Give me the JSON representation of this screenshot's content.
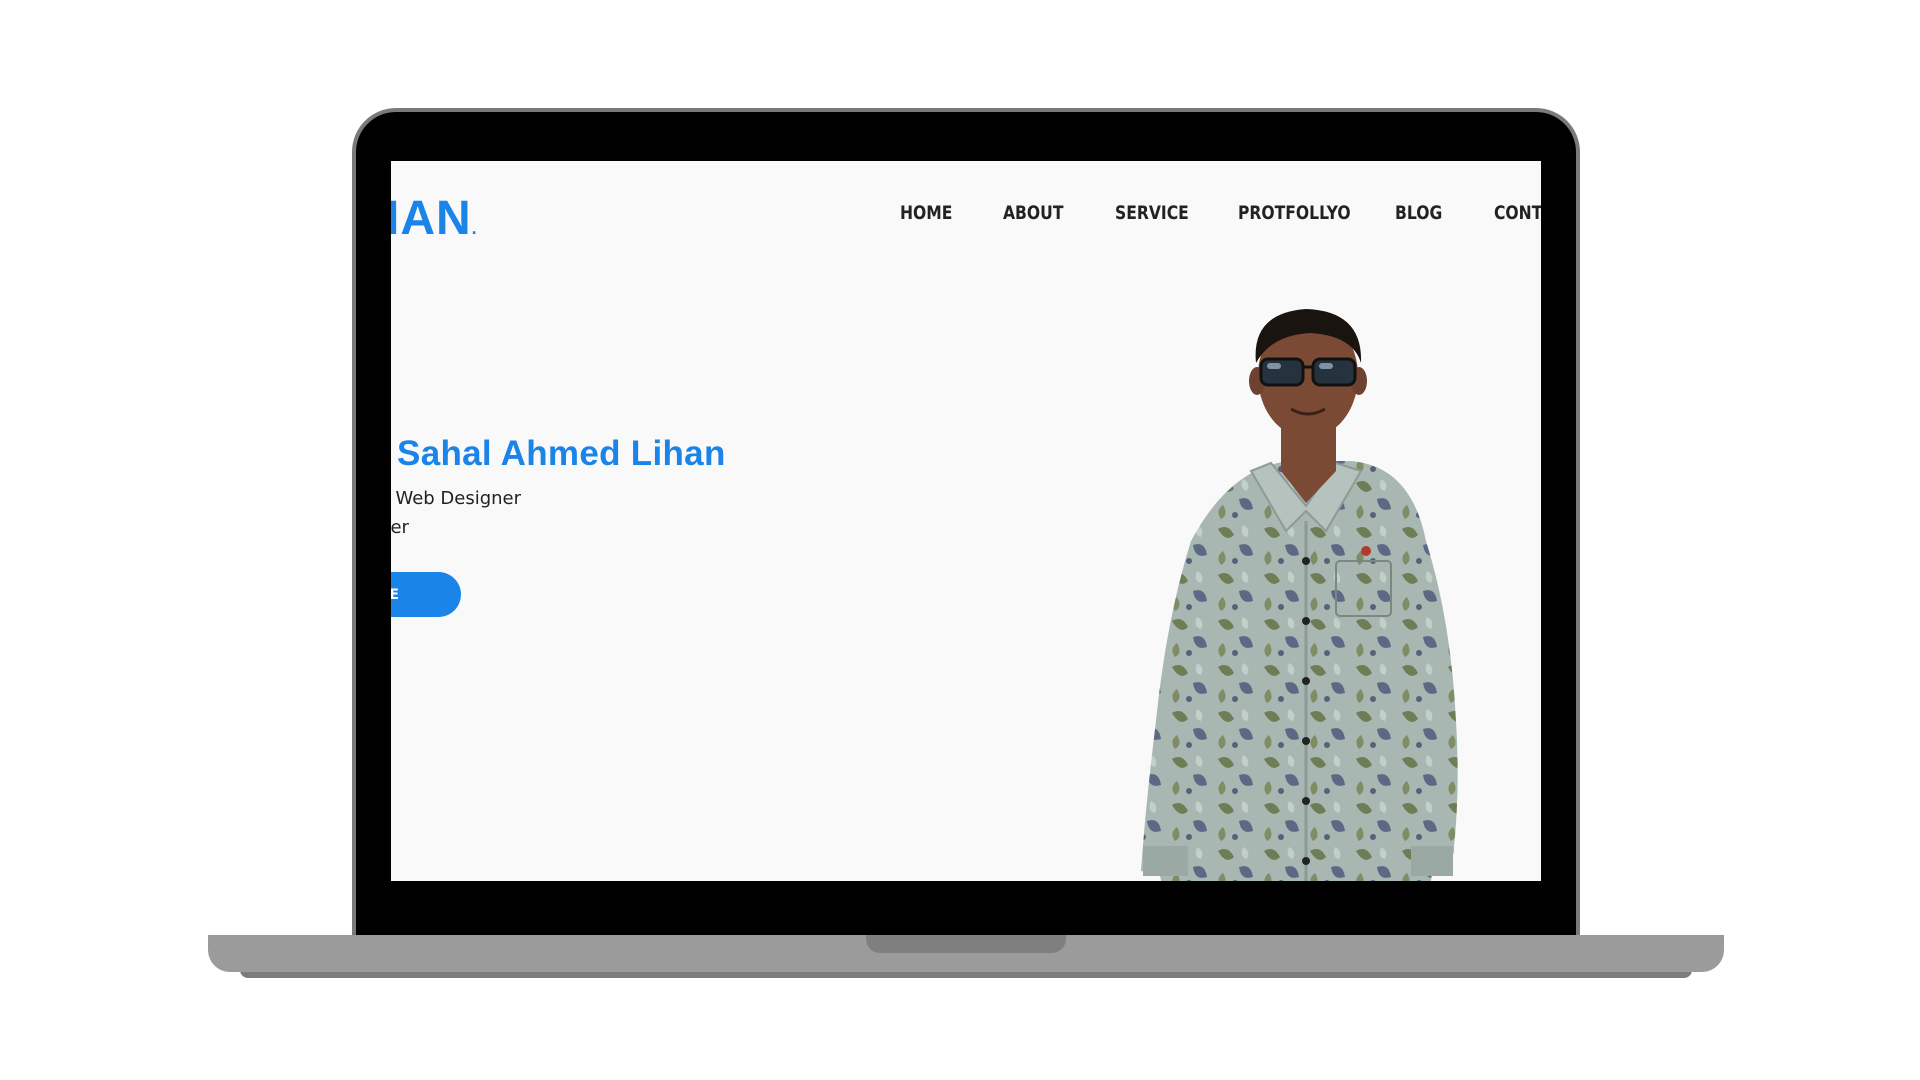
{
  "site": {
    "logo_text": "IAN",
    "logo_dot": "."
  },
  "nav": {
    "items": [
      {
        "label": "HOME"
      },
      {
        "label": "ABOUT"
      },
      {
        "label": "SERVICE"
      },
      {
        "label": "PROTFOLLYO"
      },
      {
        "label": "BLOG"
      },
      {
        "label": "CONTA"
      }
    ]
  },
  "hero": {
    "name": "I Sahal Ahmed Lihan",
    "line1": "ive Web Designer",
    "line2": "loper",
    "button_label": "RE",
    "photo": "portrait-photo"
  },
  "colors": {
    "accent": "#1a84e8",
    "screen_bg": "#f9f9f9",
    "frame": "#000000",
    "base": "#9b9b9b"
  }
}
